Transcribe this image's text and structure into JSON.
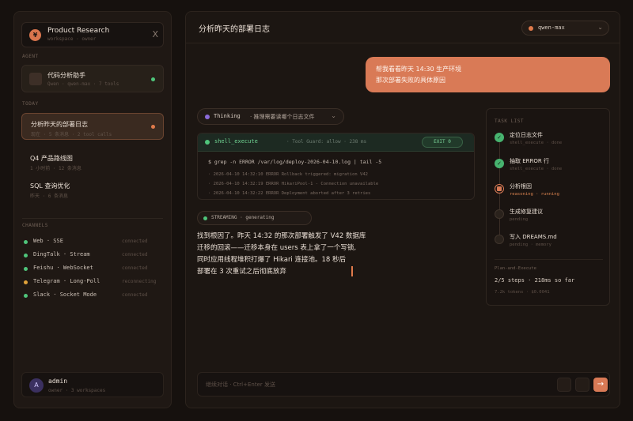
{
  "sidebar": {
    "workspace": {
      "logo": "¥",
      "name": "Product Research",
      "sub": "workspace · owner",
      "close": "X"
    },
    "agent_label": "AGENT",
    "agent": {
      "name": "代码分析助手",
      "meta": "Qwen · qwen-max · 7 tools",
      "status_color": "#4fc57b"
    },
    "today_label": "TODAY",
    "conversations": [
      {
        "title": "分析昨天的部署日志",
        "meta": "现在 · 5 条消息 · 2 tool calls",
        "active": true
      },
      {
        "title": "Q4 产品路线图",
        "meta": "1 小时前 · 12 条消息",
        "active": false
      },
      {
        "title": "SQL 查询优化",
        "meta": "昨天 · 6 条消息",
        "active": false
      }
    ],
    "channels_label": "CHANNELS",
    "channels": [
      {
        "name": "Web · SSE",
        "status": "connected",
        "color": "#4fc57b"
      },
      {
        "name": "DingTalk · Stream",
        "status": "connected",
        "color": "#4fc57b"
      },
      {
        "name": "Feishu · WebSocket",
        "status": "connected",
        "color": "#4fc57b"
      },
      {
        "name": "Telegram · Long-Poll",
        "status": "reconnecting",
        "color": "#e0a23a"
      },
      {
        "name": "Slack · Socket Mode",
        "status": "connected",
        "color": "#4fc57b"
      }
    ],
    "user": {
      "initial": "A",
      "name": "admin",
      "meta": "owner · 3 workspaces"
    }
  },
  "main": {
    "title": "分析昨天的部署日志",
    "model": "qwen-max",
    "user_message": [
      "帮我看看昨天 14:30 生产环境",
      "那次部署失败的具体原因"
    ],
    "thinking": {
      "label": "Thinking",
      "text": "· 推理需要读哪个日志文件"
    },
    "tool": {
      "name": "shell_execute",
      "meta": "· Tool Guard: allow · 238 ms",
      "exit": "EXIT 0",
      "command": "$  grep -n ERROR /var/log/deploy-2026-04-10.log | tail -5",
      "lines": [
        "·  2026-04-10 14:32:10 ERROR Rollback triggered: migration V42",
        "·  2026-04-10 14:32:19 ERROR HikariPool-1 - Connection unavailable",
        "·  2026-04-10 14:32:22 ERROR Deployment aborted after 3 retries"
      ]
    },
    "streaming_label": "STREAMING · generating",
    "answer": [
      "找到根因了。昨天 14:32 的那次部署触发了 V42 数据库",
      "迁移的回滚——迁移本身在 users 表上拿了一个写锁,",
      "同时应用线程堆积打爆了 Hikari 连接池。18 秒后",
      "部署在 3 次重试之后彻底放弃"
    ],
    "composer_placeholder": "继续对话 · Ctrl+Enter 发送",
    "send_icon": "→"
  },
  "tasks": {
    "title": "TASK LIST",
    "items": [
      {
        "title": "定位日志文件",
        "meta": "shell_execute · done",
        "state": "done"
      },
      {
        "title": "抽取 ERROR 行",
        "meta": "shell_execute · done",
        "state": "done"
      },
      {
        "title": "分析根因",
        "meta": "reasoning · running",
        "state": "running"
      },
      {
        "title": "生成修复建议",
        "meta": "pending",
        "state": "pending"
      },
      {
        "title": "写入 DREAMS.md",
        "meta": "pending · memory",
        "state": "pending"
      }
    ],
    "plan_label": "Plan-and-Execute",
    "plan_steps": "2/5 steps · 218ms so far",
    "plan_meta": "7.2k tokens · $0.0041"
  },
  "colors": {
    "accent": "#d97a56",
    "success": "#4fc57b",
    "warning": "#e0a23a",
    "thinking": "#8a6ad9"
  }
}
